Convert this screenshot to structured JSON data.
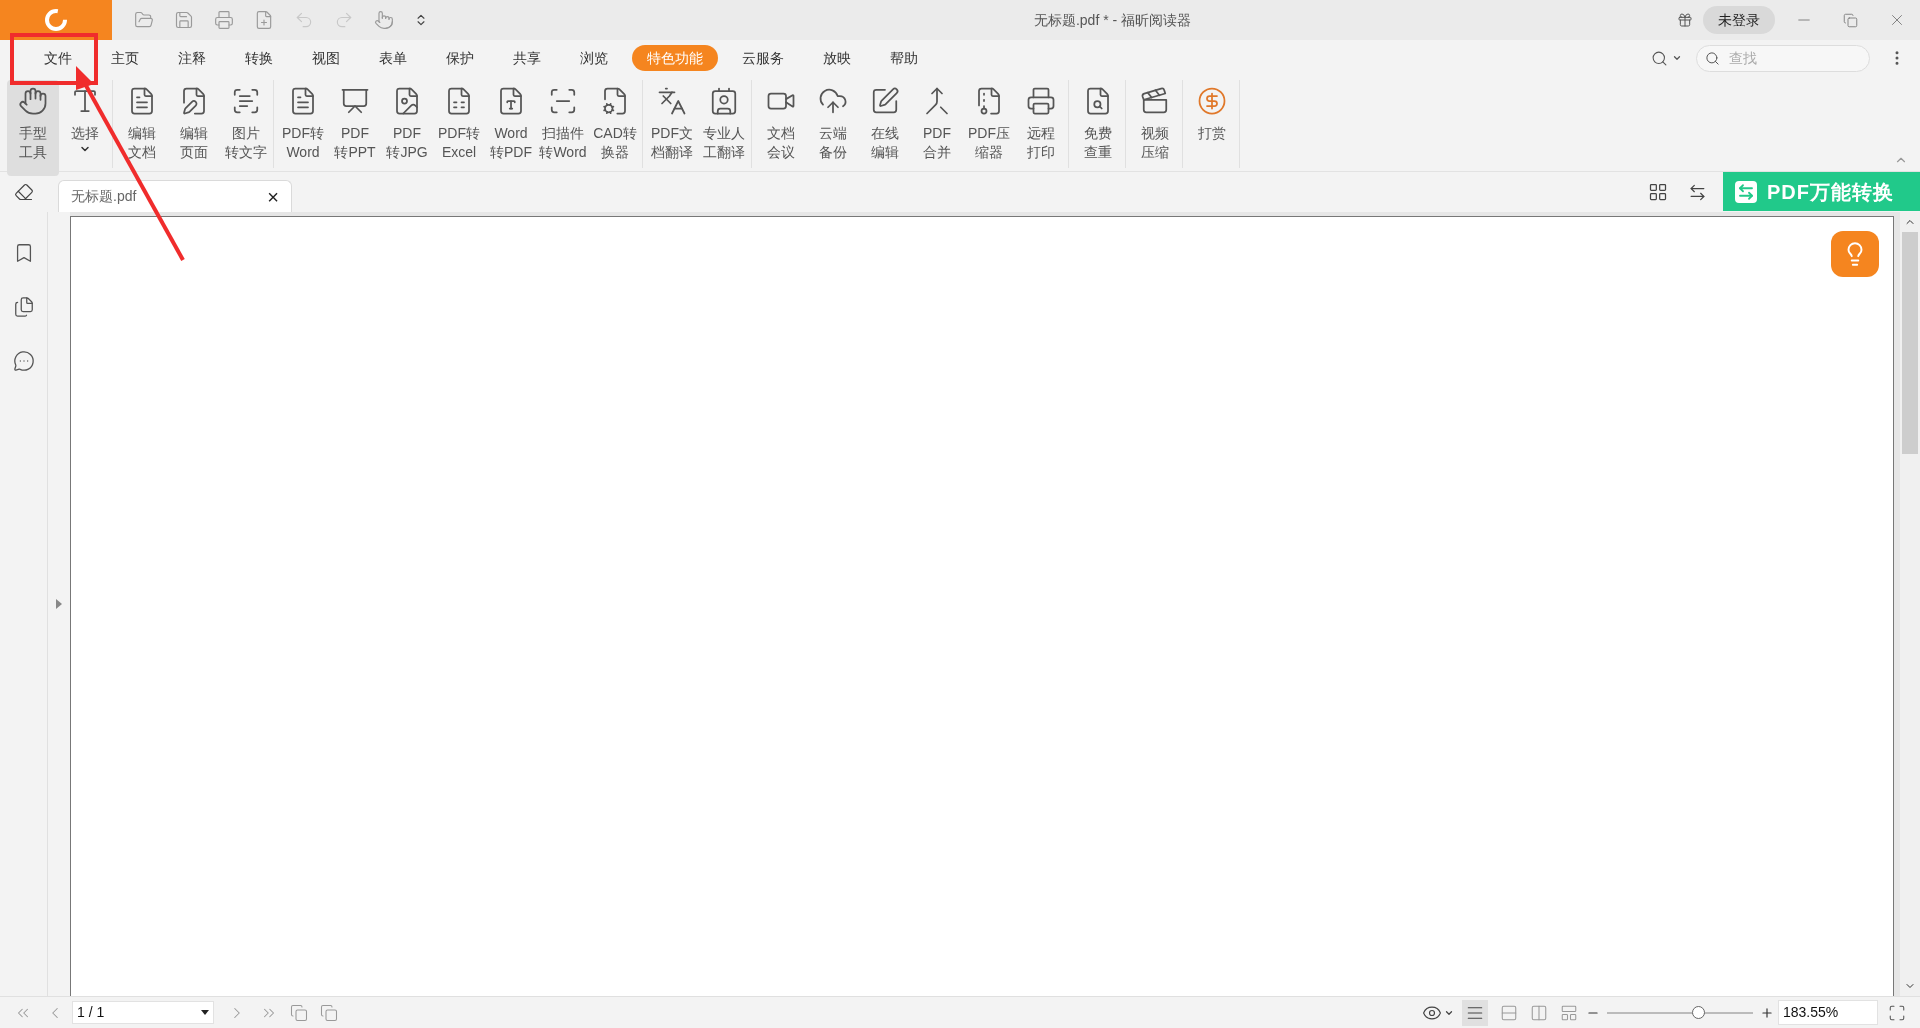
{
  "window": {
    "title": "无标题.pdf * - 福昕阅读器",
    "login_button": "未登录"
  },
  "menu_tabs": [
    {
      "label": "文件",
      "selected": false
    },
    {
      "label": "主页",
      "selected": false
    },
    {
      "label": "注释",
      "selected": false
    },
    {
      "label": "转换",
      "selected": false
    },
    {
      "label": "视图",
      "selected": false
    },
    {
      "label": "表单",
      "selected": false
    },
    {
      "label": "保护",
      "selected": false
    },
    {
      "label": "共享",
      "selected": false
    },
    {
      "label": "浏览",
      "selected": false
    },
    {
      "label": "特色功能",
      "selected": true
    },
    {
      "label": "云服务",
      "selected": false
    },
    {
      "label": "放映",
      "selected": false
    },
    {
      "label": "帮助",
      "selected": false
    }
  ],
  "search": {
    "placeholder": "查找"
  },
  "ribbon_groups": [
    [
      {
        "kind": "hand",
        "lines": [
          "手型",
          "工具"
        ],
        "selected": true
      },
      {
        "kind": "select",
        "lines": [
          "选择"
        ],
        "selected": false,
        "dropdown": true
      }
    ],
    [
      {
        "kind": "edit-doc",
        "lines": [
          "编辑",
          "文档"
        ],
        "selected": false
      },
      {
        "kind": "edit-page",
        "lines": [
          "编辑",
          "页面"
        ],
        "selected": false
      },
      {
        "kind": "ocr",
        "lines": [
          "图片",
          "转文字"
        ],
        "selected": false
      }
    ],
    [
      {
        "kind": "to-word",
        "lines": [
          "PDF转",
          "Word"
        ],
        "selected": false
      },
      {
        "kind": "to-ppt",
        "lines": [
          "PDF",
          "转PPT"
        ],
        "selected": false
      },
      {
        "kind": "to-jpg",
        "lines": [
          "PDF",
          "转JPG"
        ],
        "selected": false
      },
      {
        "kind": "to-excel",
        "lines": [
          "PDF转",
          "Excel"
        ],
        "selected": false
      },
      {
        "kind": "word-pdf",
        "lines": [
          "Word",
          "转PDF"
        ],
        "selected": false
      },
      {
        "kind": "scan",
        "lines": [
          "扫描件",
          "转Word"
        ],
        "selected": false
      },
      {
        "kind": "cad",
        "lines": [
          "CAD转",
          "换器"
        ],
        "selected": false
      }
    ],
    [
      {
        "kind": "translate",
        "lines": [
          "PDF文",
          "档翻译"
        ],
        "selected": false
      },
      {
        "kind": "human",
        "lines": [
          "专业人",
          "工翻译"
        ],
        "selected": false
      }
    ],
    [
      {
        "kind": "meeting",
        "lines": [
          "文档",
          "会议"
        ],
        "selected": false
      },
      {
        "kind": "cloud",
        "lines": [
          "云端",
          "备份"
        ],
        "selected": false
      },
      {
        "kind": "online-edit",
        "lines": [
          "在线",
          "编辑"
        ],
        "selected": false
      },
      {
        "kind": "merge",
        "lines": [
          "PDF",
          "合并"
        ],
        "selected": false
      },
      {
        "kind": "compress",
        "lines": [
          "PDF压",
          "缩器"
        ],
        "selected": false
      },
      {
        "kind": "print",
        "lines": [
          "远程",
          "打印"
        ],
        "selected": false
      }
    ],
    [
      {
        "kind": "check",
        "lines": [
          "免费",
          "查重"
        ],
        "selected": false
      }
    ],
    [
      {
        "kind": "video",
        "lines": [
          "视频",
          "压缩"
        ],
        "selected": false
      }
    ],
    [
      {
        "kind": "reward",
        "lines": [
          "打赏"
        ],
        "selected": false
      }
    ]
  ],
  "document_tab": {
    "title": "无标题.pdf",
    "close": "×"
  },
  "banner": {
    "label": "PDF万能转换"
  },
  "status_bar": {
    "page": "1 / 1",
    "zoom": {
      "level": 0.63,
      "reading": "183.55%"
    }
  }
}
